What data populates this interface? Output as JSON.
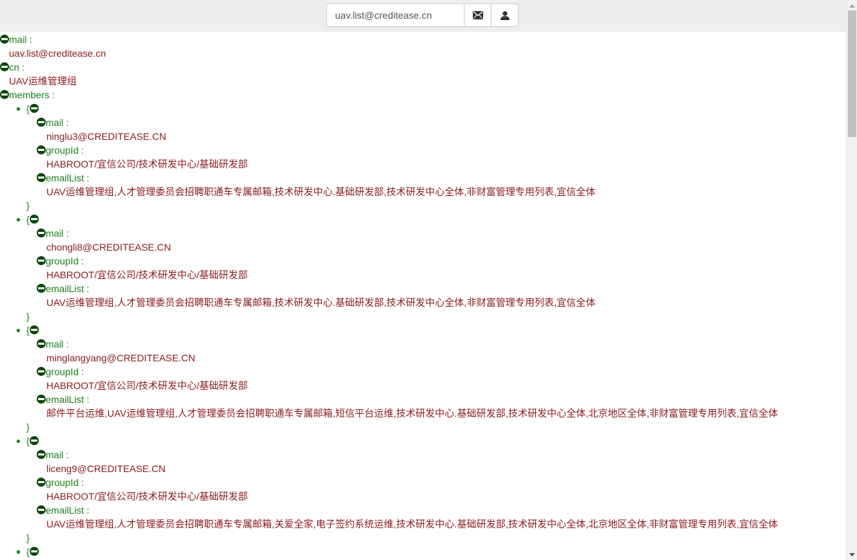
{
  "search": {
    "value": "uav.list@creditease.cn"
  },
  "buttons": {
    "mail_icon": "envelope-icon",
    "user_icon": "user-icon"
  },
  "colors": {
    "key": "#1a7f1a",
    "value": "#8b1a1a",
    "toggle": "#0d470d"
  },
  "tree": {
    "mail_key": "mail :",
    "mail_value": "uav.list@creditease.cn",
    "cn_key": "cn :",
    "cn_value": "UAV运维管理组",
    "members_key": "members :",
    "open_brace": "{",
    "close_brace": "}",
    "member_keys": {
      "mail": "mail :",
      "groupId": "groupId :",
      "emailList": "emailList :"
    },
    "members": [
      {
        "mail": "ninglu3@CREDITEASE.CN",
        "groupId": "HABROOT/宜信公司/技术研发中心/基础研发部",
        "emailList": "UAV运维管理组,人才管理委员会招聘职通车专属邮箱,技术研发中心.基础研发部,技术研发中心全体,非财富管理专用列表,宜信全体"
      },
      {
        "mail": "chongli8@CREDITEASE.CN",
        "groupId": "HABROOT/宜信公司/技术研发中心/基础研发部",
        "emailList": "UAV运维管理组,人才管理委员会招聘职通车专属邮箱,技术研发中心.基础研发部,技术研发中心全体,非财富管理专用列表,宜信全体"
      },
      {
        "mail": "minglangyang@CREDITEASE.CN",
        "groupId": "HABROOT/宜信公司/技术研发中心/基础研发部",
        "emailList": "邮件平台运维,UAV运维管理组,人才管理委员会招聘职通车专属邮箱,短信平台运维,技术研发中心.基础研发部,技术研发中心全体,北京地区全体,非财富管理专用列表,宜信全体"
      },
      {
        "mail": "liceng9@CREDITEASE.CN",
        "groupId": "HABROOT/宜信公司/技术研发中心/基础研发部",
        "emailList": "UAV运维管理组,人才管理委员会招聘职通车专属邮箱,关爱全家,电子签约系统运维,技术研发中心.基础研发部,技术研发中心全体,北京地区全体,非财富管理专用列表,宜信全体"
      }
    ]
  }
}
